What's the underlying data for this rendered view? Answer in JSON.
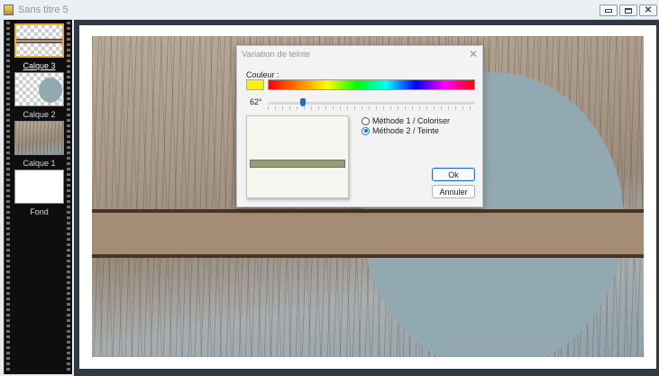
{
  "window": {
    "title": "Sans titre 5"
  },
  "layers": [
    {
      "label": "Calque 3",
      "selected": true
    },
    {
      "label": "Calque 2",
      "selected": false
    },
    {
      "label": "Calque 1",
      "selected": false
    },
    {
      "label": "Fond",
      "selected": false
    }
  ],
  "dialog": {
    "title": "Variation de teinte",
    "couleur_label": "Couleur :",
    "angle_value": "62°",
    "hue_slider_fraction": 0.17,
    "preview_bar_color": "#979b78",
    "selected_color": "#f5f016",
    "methods": [
      {
        "label": "Méthode 1 / Coloriser",
        "checked": false
      },
      {
        "label": "Méthode 2 / Teinte",
        "checked": true
      }
    ],
    "ok_label": "Ok",
    "cancel_label": "Annuler"
  }
}
